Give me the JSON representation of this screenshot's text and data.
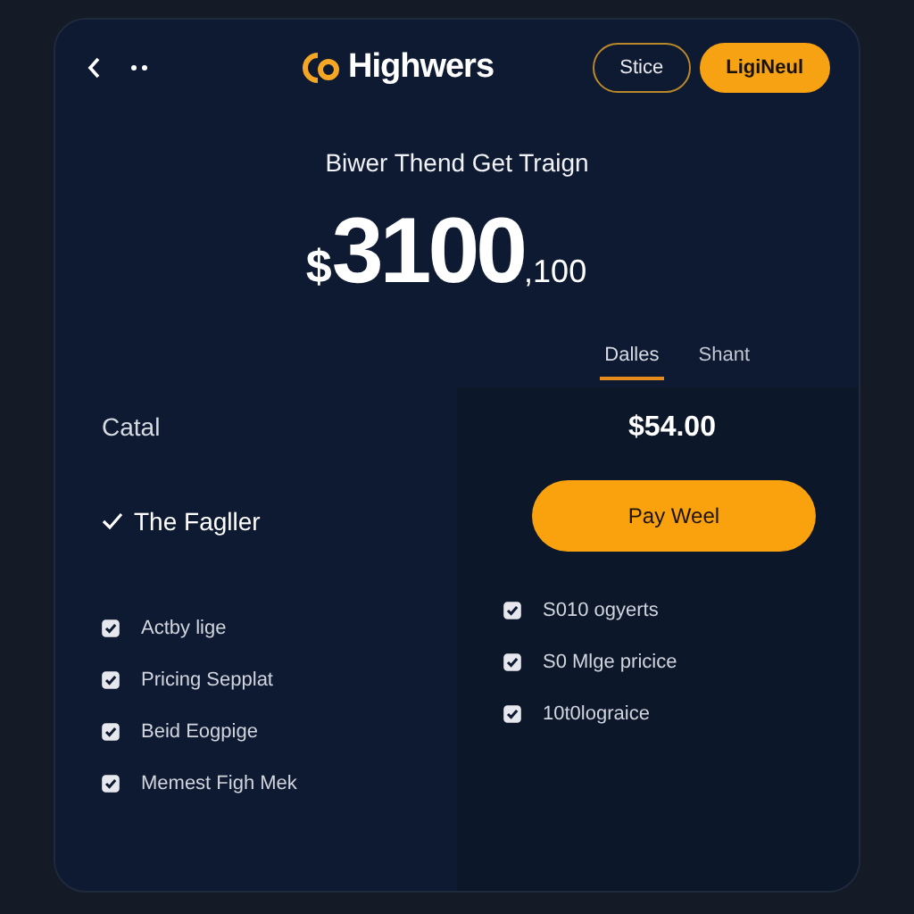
{
  "header": {
    "brand": "Highwers",
    "buttons": [
      {
        "label": "Stice",
        "kind": "outline"
      },
      {
        "label": "LigiNeul",
        "kind": "filled"
      }
    ]
  },
  "tagline": "Biwer Thend Get Traign",
  "price": {
    "currency": "$",
    "amount": "3100",
    "fraction": ",100"
  },
  "tabs": [
    {
      "label": "Dalles",
      "selected": true
    },
    {
      "label": "Shant",
      "selected": false
    }
  ],
  "left": {
    "label": "Catal",
    "plan": {
      "label": "The Fagller",
      "checked": true
    },
    "features": [
      {
        "label": "Actby lige",
        "checked": true
      },
      {
        "label": "Pricing Sepplat",
        "checked": true
      },
      {
        "label": "Beid Eogpige",
        "checked": true
      },
      {
        "label": "Memest Figh Mek",
        "checked": true
      }
    ]
  },
  "right": {
    "total": "$54.00",
    "pay_button": "Pay Weel",
    "features": [
      {
        "label": "S010 ogyerts",
        "checked": true
      },
      {
        "label": "S0 Mlge pricice",
        "checked": true
      },
      {
        "label": "10t0lograice",
        "checked": true
      }
    ]
  }
}
